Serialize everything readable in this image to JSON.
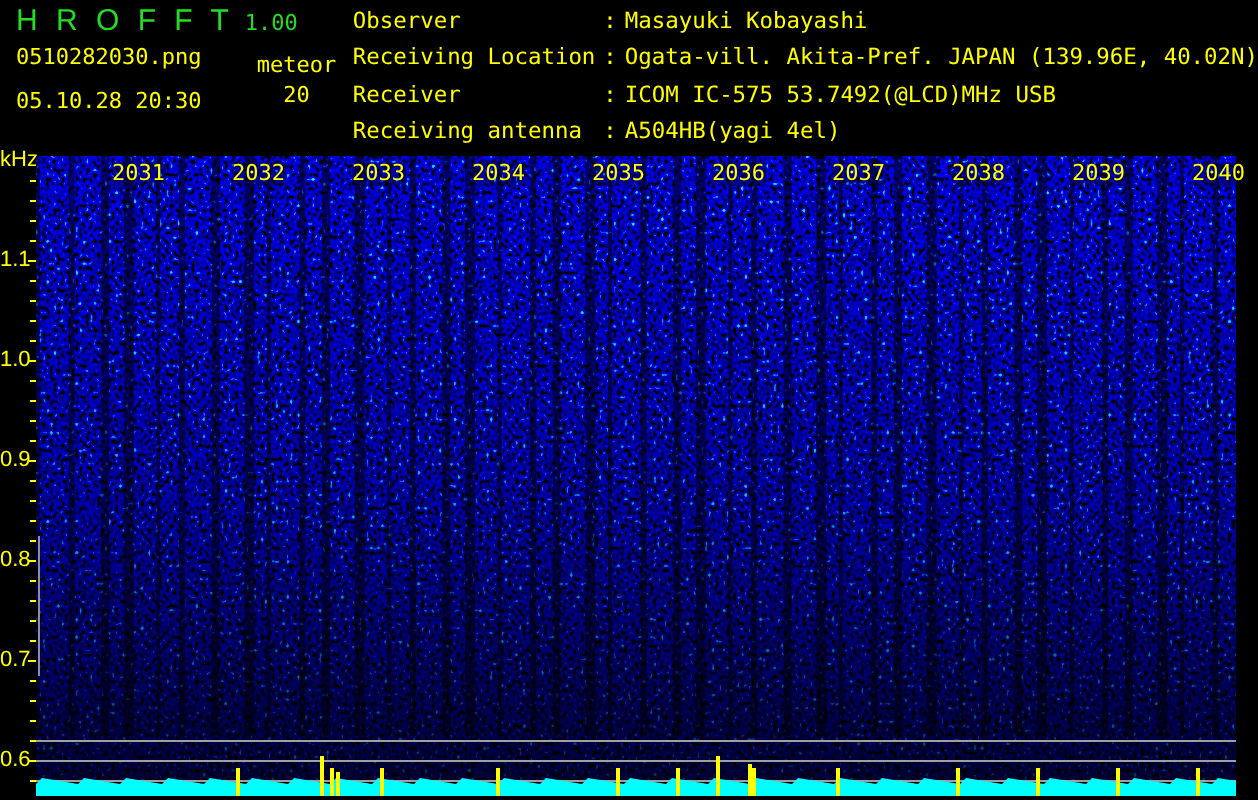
{
  "app": {
    "name": "H R O F F T",
    "version": "1.00"
  },
  "file": {
    "filename": "0510282030.png",
    "datetime": "05.10.28 20:30"
  },
  "meteor": {
    "label": "meteor",
    "count": "20"
  },
  "station": [
    {
      "label": "Observer",
      "separator": ":",
      "value": "Masayuki Kobayashi"
    },
    {
      "label": "Receiving Location",
      "separator": ":",
      "value": "Ogata-vill. Akita-Pref. JAPAN (139.96E, 40.02N)"
    },
    {
      "label": "Receiver",
      "separator": ":",
      "value": "ICOM IC-575 53.7492(@LCD)MHz USB"
    },
    {
      "label": "Receiving antenna",
      "separator": ":",
      "value": "A504HB(yagi 4el)"
    }
  ],
  "spectrogram": {
    "unit": "kHz",
    "time_labels": [
      "2031",
      "2032",
      "2033",
      "2034",
      "2035",
      "2036",
      "2037",
      "2038",
      "2039",
      "2040"
    ],
    "frequency_labels": [
      "1.1",
      "1.0",
      "0.9",
      "0.8",
      "0.7",
      "0.6"
    ]
  }
}
